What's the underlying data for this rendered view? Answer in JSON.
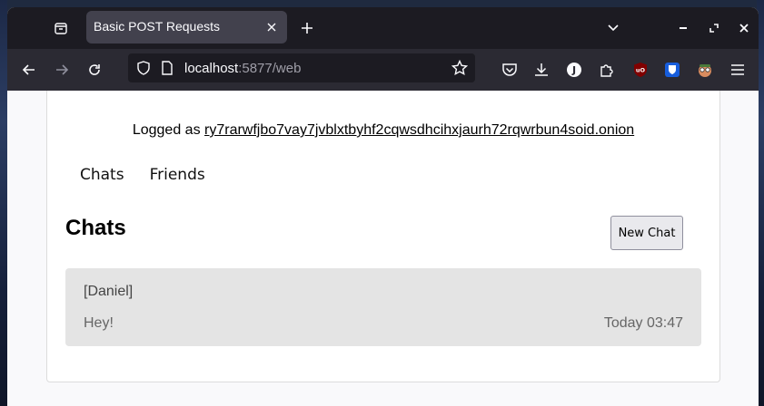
{
  "browser": {
    "tab_title": "Basic POST Requests",
    "url_host": "localhost",
    "url_rest": ":5877/web",
    "colors": {
      "tabbar": "#1c1b22",
      "navbar": "#2b2a33",
      "active_tab": "#42414d"
    },
    "icons": [
      "tab-overview-icon",
      "close-icon",
      "plus-icon",
      "chevron-down-icon",
      "minimize-icon",
      "maximize-icon",
      "back-icon",
      "forward-icon",
      "reload-icon",
      "shield-icon",
      "page-icon",
      "bookmark-star-icon",
      "pocket-icon",
      "download-icon",
      "extension-j-icon",
      "extensions-puzzle-icon",
      "ublock-icon",
      "bitwarden-icon",
      "mascot-extension-icon",
      "menu-icon"
    ],
    "extension_j_label": "J",
    "ublock_label": "uO"
  },
  "page": {
    "logged_prefix": "Logged as ",
    "onion_address": "ry7rarwfjbo7vay7jvblxtbyhf2cqwsdhcihxjaurh72rqwrbun4soid.onion",
    "nav": {
      "chats": "Chats",
      "friends": "Friends"
    },
    "chats_heading": "Chats",
    "new_chat_label": "New Chat",
    "chats": [
      {
        "name": "[Daniel]",
        "last_message": "Hey!",
        "time": "Today 03:47"
      }
    ]
  }
}
